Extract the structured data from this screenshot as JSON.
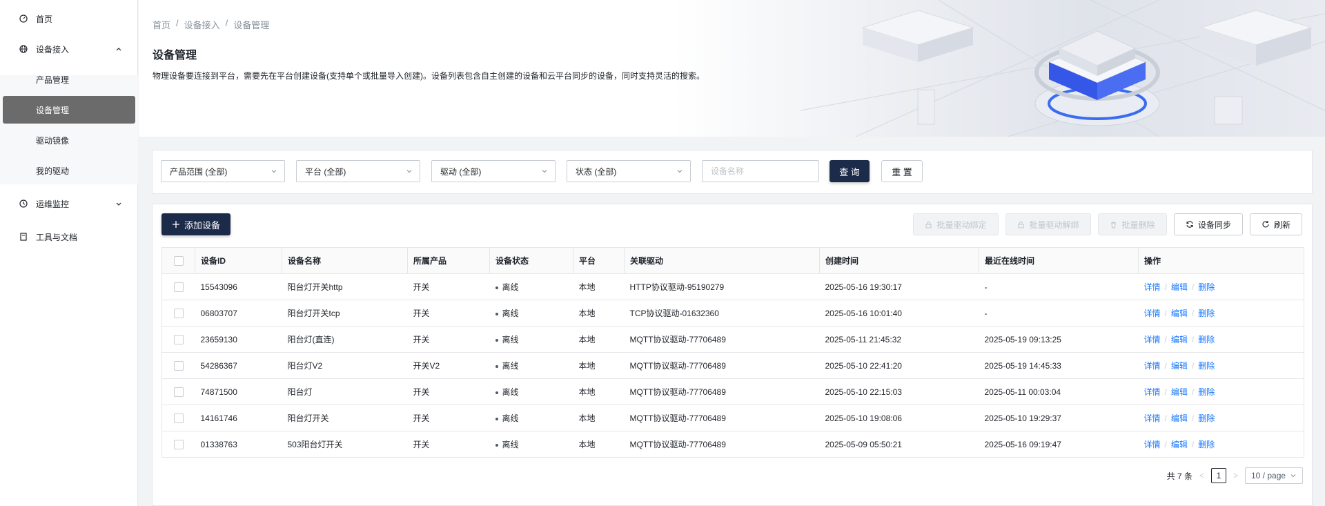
{
  "sidebar": {
    "items": [
      {
        "label": "首页",
        "icon": "dashboard-icon"
      },
      {
        "label": "设备接入",
        "icon": "globe-icon",
        "expanded": true
      },
      {
        "label": "运维监控",
        "icon": "monitor-icon",
        "expanded": false
      },
      {
        "label": "工具与文档",
        "icon": "document-icon"
      }
    ],
    "sub_items": [
      {
        "label": "产品管理"
      },
      {
        "label": "设备管理",
        "active": true
      },
      {
        "label": "驱动镜像"
      },
      {
        "label": "我的驱动"
      }
    ]
  },
  "breadcrumb": [
    "首页",
    "设备接入",
    "设备管理"
  ],
  "breadcrumb_sep": "/",
  "page": {
    "title": "设备管理",
    "description": "物理设备要连接到平台，需要先在平台创建设备(支持单个或批量导入创建)。设备列表包含自主创建的设备和云平台同步的设备，同时支持灵活的搜索。"
  },
  "filters": {
    "product": "产品范围 (全部)",
    "platform": "平台 (全部)",
    "driver": "驱动 (全部)",
    "status": "状态 (全部)",
    "name_placeholder": "设备名称",
    "query_label": "查 询",
    "reset_label": "重 置"
  },
  "toolbar": {
    "add_label": "添加设备",
    "batch_bind": "批量驱动绑定",
    "batch_unbind": "批量驱动解绑",
    "batch_delete": "批量删除",
    "sync": "设备同步",
    "refresh": "刷新"
  },
  "table": {
    "headers": [
      "设备ID",
      "设备名称",
      "所属产品",
      "设备状态",
      "平台",
      "关联驱动",
      "创建时间",
      "最近在线时间",
      "操作"
    ],
    "rows": [
      {
        "id": "15543096",
        "name": "阳台灯开关http",
        "product": "开关",
        "status": "离线",
        "platform": "本地",
        "driver": "HTTP协议驱动-95190279",
        "created": "2025-05-16 19:30:17",
        "last_online": "-"
      },
      {
        "id": "06803707",
        "name": "阳台灯开关tcp",
        "product": "开关",
        "status": "离线",
        "platform": "本地",
        "driver": "TCP协议驱动-01632360",
        "created": "2025-05-16 10:01:40",
        "last_online": "-"
      },
      {
        "id": "23659130",
        "name": "阳台灯(直连)",
        "product": "开关",
        "status": "离线",
        "platform": "本地",
        "driver": "MQTT协议驱动-77706489",
        "created": "2025-05-11 21:45:32",
        "last_online": "2025-05-19 09:13:25"
      },
      {
        "id": "54286367",
        "name": "阳台灯V2",
        "product": "开关V2",
        "status": "离线",
        "platform": "本地",
        "driver": "MQTT协议驱动-77706489",
        "created": "2025-05-10 22:41:20",
        "last_online": "2025-05-19 14:45:33"
      },
      {
        "id": "74871500",
        "name": "阳台灯",
        "product": "开关",
        "status": "离线",
        "platform": "本地",
        "driver": "MQTT协议驱动-77706489",
        "created": "2025-05-10 22:15:03",
        "last_online": "2025-05-11 00:03:04"
      },
      {
        "id": "14161746",
        "name": "阳台灯开关",
        "product": "开关",
        "status": "离线",
        "platform": "本地",
        "driver": "MQTT协议驱动-77706489",
        "created": "2025-05-10 19:08:06",
        "last_online": "2025-05-10 19:29:37"
      },
      {
        "id": "01338763",
        "name": "503阳台灯开关",
        "product": "开关",
        "status": "离线",
        "platform": "本地",
        "driver": "MQTT协议驱动-77706489",
        "created": "2025-05-09 05:50:21",
        "last_online": "2025-05-16 09:19:47"
      }
    ],
    "actions": [
      "详情",
      "编辑",
      "删除"
    ]
  },
  "pagination": {
    "total": "共 7 条",
    "current": "1",
    "page_size": "10 / page"
  },
  "colors": {
    "primary": "#1c2b4a",
    "link": "#1677ff",
    "active_nav": "#6b6b6b"
  }
}
